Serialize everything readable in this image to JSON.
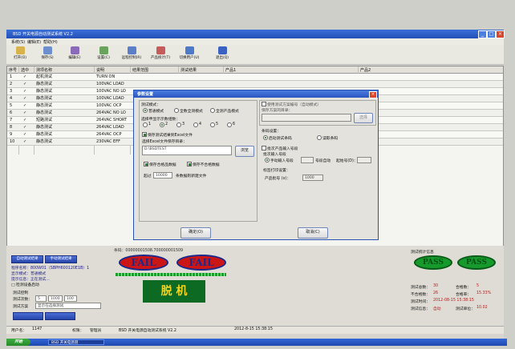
{
  "window": {
    "title": "BSD  开关电源自动测试系统 V2.2",
    "controls": [
      "_",
      "□",
      "×"
    ]
  },
  "menu": [
    "系统(S)",
    "编辑(E)",
    "帮助(H)"
  ],
  "toolbar": [
    {
      "label": "打开(O)",
      "icon": "open-folder-icon",
      "color": "#d8b24a"
    },
    {
      "label": "保存(S)",
      "icon": "save-icon",
      "color": "#6d8fcf"
    },
    {
      "label": "编辑(E)",
      "icon": "edit-icon",
      "color": "#8a6bb8"
    },
    {
      "label": "设置(C)",
      "icon": "settings-icon",
      "color": "#6aa35c"
    },
    {
      "label": "远程控制(R)",
      "icon": "remote-icon",
      "color": "#5a7fc8"
    },
    {
      "label": "产品统计(T)",
      "icon": "stats-icon",
      "color": "#c65b5b"
    },
    {
      "label": "切换用户(U)",
      "icon": "user-icon",
      "color": "#4c7ac9"
    },
    {
      "label": "退出(Q)",
      "icon": "exit-icon",
      "color": "#3b62c2"
    }
  ],
  "grid": {
    "headers": [
      "序号",
      "选中",
      "测项名称",
      "说明",
      "结果范围",
      "测试结果",
      "产品1",
      "产品2"
    ],
    "rows": [
      {
        "no": "1",
        "name": "起机测试",
        "desc": "TURN ON"
      },
      {
        "no": "2",
        "name": "静态测试",
        "desc": "100VAC LOAD"
      },
      {
        "no": "3",
        "name": "静态测试",
        "desc": "100VAC NO LO"
      },
      {
        "no": "4",
        "name": "静态测试",
        "desc": "100VAC LOAD"
      },
      {
        "no": "5",
        "name": "静态测试",
        "desc": "100VAC OCP"
      },
      {
        "no": "6",
        "name": "静态测试",
        "desc": "264VAC NO LO"
      },
      {
        "no": "7",
        "name": "短路测试",
        "desc": "264VAC SHORT"
      },
      {
        "no": "8",
        "name": "静态测试",
        "desc": "264VAC LOAD"
      },
      {
        "no": "9",
        "name": "静态测试",
        "desc": "264VAC OCP"
      },
      {
        "no": "10",
        "name": "静态测试",
        "desc": "230VAC EFF"
      }
    ],
    "check_mark": "✓"
  },
  "dialog": {
    "title": "参数设置",
    "test_mode_label": "测试模式：",
    "modes": [
      "普通模式",
      "全数全测模式",
      "全测产品模式"
    ],
    "product_count_label": "选择申显示示数组数：",
    "product_counts": [
      "1",
      "2",
      "3",
      "4",
      "5",
      "6"
    ],
    "save_excel_label": "保存测试结果到Excel文件",
    "excel_path_label": "选择Excel文件保存目录：",
    "excel_path": "D:\\BSDTEST",
    "browse_label": "浏览",
    "save_pass_label": "保存合格品数据",
    "save_fail_label": "保存不合格数据",
    "interval_label": "超过",
    "interval_value": "10000",
    "interval_suffix": "条数据则新建文件",
    "custom_dir_label": "使用测试方案编号（自动模式）",
    "custom_dir_sub": "保存方案的目录：",
    "select_label": "选择",
    "barcode_label": "条码设置：",
    "barcode_opts": [
      "启动测试条码",
      "读取条码"
    ],
    "scan_label": "批次产品输入号段",
    "scan_sub": "批次输入号段",
    "scan_opts": [
      "手动输入号段",
      "号段自动"
    ],
    "scan_len_label": "产品长度：",
    "scan_len_value": "",
    "start_label": "起始号(D)：",
    "start_value": "",
    "print_label": "标签打印设置：",
    "print_sub": "产品批号 (x)：",
    "print_value": "1000",
    "ok_label": "确定(O)",
    "cancel_label": "取消(C)"
  },
  "bottom": {
    "left_buttons": [
      "自动测试结果",
      "手动测试结果"
    ],
    "info": [
      "程序名称：800W01（SBPH600120E1B）1",
      "显示模式：普通模式",
      "提示信息：正在测试...",
      "□ 检测设备启动"
    ],
    "lower_labels": [
      "测试控制",
      "测试次数：",
      "测试方案"
    ],
    "lower_values": [
      "5",
      "1000",
      "100"
    ],
    "scheme_value": "显示在选择测试",
    "barcode_text": "条码：00000001508.700000001509",
    "fail_label": "FAIL",
    "result_text": "脱 机",
    "pass_label": "PASS",
    "right_title": "测试统计信息",
    "stats": [
      [
        "测试总数：",
        "30",
        "合格数：",
        "5"
      ],
      [
        "不合格数：",
        "26",
        "合格率：",
        "15.33%"
      ],
      [
        "测试时间：",
        "2012-08-15 15:38:15",
        "",
        ""
      ],
      [
        "测试信息：",
        "自动",
        "测试单位：",
        "10.02"
      ]
    ]
  },
  "status": {
    "user_label": "用户名：",
    "user_value": "1147",
    "perm_label": "权限：",
    "perm_value": "管理员",
    "system": "BSD  开关电源自动测试系统  V2.2",
    "date": "2012-8-15  15:38:15"
  },
  "taskbar": {
    "start": "开始",
    "item": "BSD  开关电源测"
  }
}
